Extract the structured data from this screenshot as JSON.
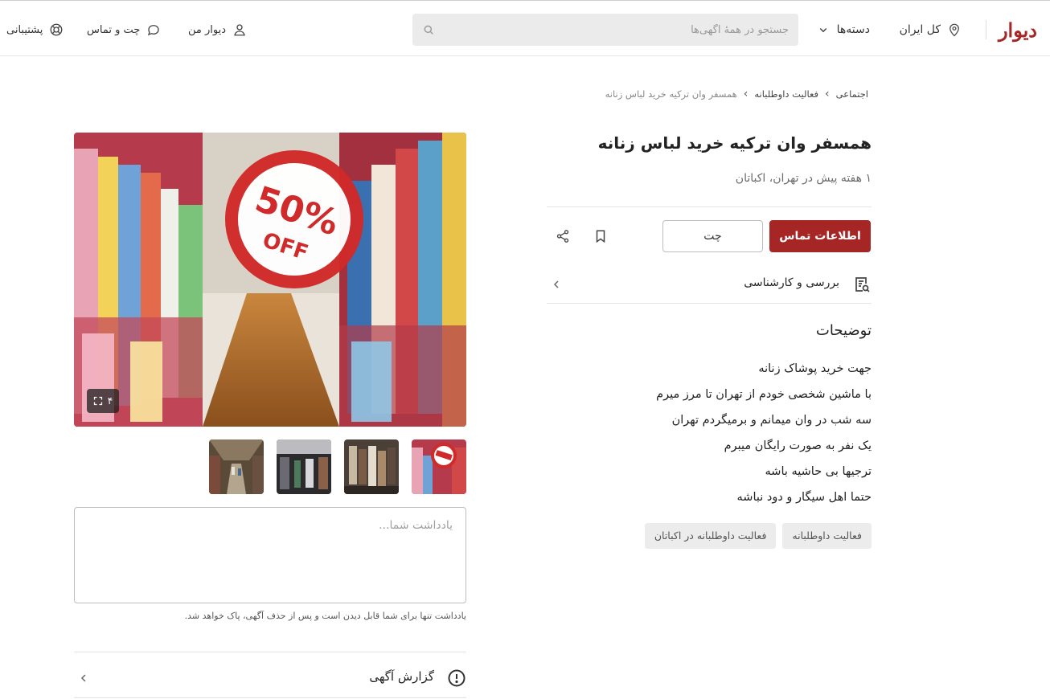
{
  "header": {
    "logo": "دیوار",
    "city": "کل ایران",
    "categories": "دسته‌ها",
    "search_placeholder": "جستجو در همهٔ آگهی‌ها",
    "my_divar": "دیوار من",
    "chat": "چت و تماس",
    "support": "پشتیبانی"
  },
  "breadcrumb": [
    "اجتماعی",
    "فعالیت داوطلبانه",
    "همسفر وان ترکیه خرید لباس زنانه"
  ],
  "ad": {
    "title": "همسفر وان ترکیه خرید لباس زنانه",
    "subtitle": "۱ هفته پیش در تهران، اکباتان",
    "contact_button": "اطلاعات تماس",
    "chat_button": "چت",
    "review_label": "بررسی و کارشناسی",
    "description_title": "توضیحات",
    "description_lines": [
      "جهت خرید پوشاک زنانه",
      "با ماشین شخصی خودم از تهران تا مرز میرم",
      "سه شب در وان میمانم و برمیگردم تهران",
      "یک نفر به صورت رایگان میبرم",
      "ترجیها بی حاشیه باشه",
      "حتما اهل سیگار و دود نباشه"
    ],
    "tags": [
      "فعالیت داوطلبانه",
      "فعالیت داوطلبانه در اکباتان"
    ]
  },
  "gallery": {
    "main_image_text": [
      "50%",
      "OFF"
    ],
    "image_count": "۴"
  },
  "note": {
    "placeholder": "یادداشت شما...",
    "hint": "یادداشت تنها برای شما قابل دیدن است و پس از حذف آگهی، پاک خواهد شد."
  },
  "report": {
    "label": "گزارش آگهی"
  },
  "colors": {
    "brand": "#a62626",
    "divider": "#e4e4e4",
    "tag_bg": "#ececec"
  }
}
